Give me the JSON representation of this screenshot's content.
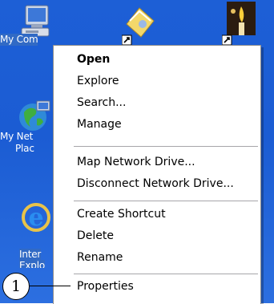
{
  "desktop": {
    "icons": [
      {
        "name": "my-computer-icon",
        "label": "My Com"
      },
      {
        "name": "my-network-places-icon",
        "label_lines": [
          "My Net",
          "Plac"
        ]
      },
      {
        "name": "internet-explorer-icon",
        "label_lines": [
          "Inter",
          "Explo"
        ]
      },
      {
        "name": "shortcut-folder-icon"
      },
      {
        "name": "shortcut-candle-icon"
      }
    ]
  },
  "context_menu": {
    "items": [
      {
        "label": "Open",
        "bold": true
      },
      {
        "label": "Explore"
      },
      {
        "label": "Search..."
      },
      {
        "label": "Manage"
      },
      {
        "label": "Map Network Drive..."
      },
      {
        "label": "Disconnect Network Drive..."
      },
      {
        "label": "Create Shortcut"
      },
      {
        "label": "Delete"
      },
      {
        "label": "Rename"
      },
      {
        "label": "Properties"
      }
    ]
  },
  "callout": {
    "number": "1"
  },
  "colors": {
    "desktop_blue": "#1d5fd6",
    "selection": "#316ac5",
    "menu_bg": "#ffffff"
  }
}
